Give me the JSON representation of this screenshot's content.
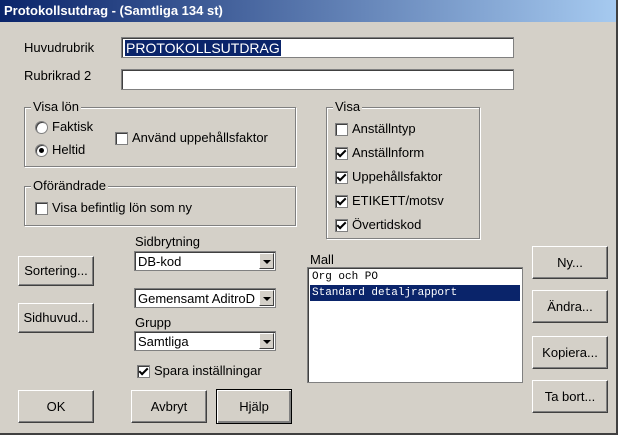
{
  "window": {
    "title": "Protokollsutdrag - (Samtliga 134 st)"
  },
  "header": {
    "huvudrubrik_label": "Huvudrubrik",
    "huvudrubrik_value": "PROTOKOLLSUTDRAG",
    "rubrikrad2_label": "Rubrikrad 2",
    "rubrikrad2_value": ""
  },
  "visa_lon": {
    "title": "Visa lön",
    "faktisk": "Faktisk",
    "heltid": "Heltid",
    "uppehall": "Använd uppehållsfaktor"
  },
  "oforandrade": {
    "title": "Oförändrade",
    "visa_befintlig": "Visa befintlig lön som ny"
  },
  "visa": {
    "title": "Visa",
    "items": [
      "Anställntyp",
      "Anställnform",
      "Uppehållsfaktor",
      "ETIKETT/motsv",
      "Övertidskod"
    ]
  },
  "sidbrytning": {
    "label": "Sidbrytning",
    "value": "DB-kod",
    "value2": "Gemensamt AditroD"
  },
  "grupp": {
    "label": "Grupp",
    "value": "Samtliga"
  },
  "spara": "Spara inställningar",
  "mall": {
    "label": "Mall",
    "items": [
      "Org och PO",
      "Standard detaljrapport"
    ]
  },
  "buttons": {
    "sortering": "Sortering...",
    "sidhuvud": "Sidhuvud...",
    "ok": "OK",
    "avbryt": "Avbryt",
    "hjalp": "Hjälp",
    "ny": "Ny...",
    "andra": "Ändra...",
    "kopiera": "Kopiera...",
    "tabort": "Ta bort..."
  }
}
